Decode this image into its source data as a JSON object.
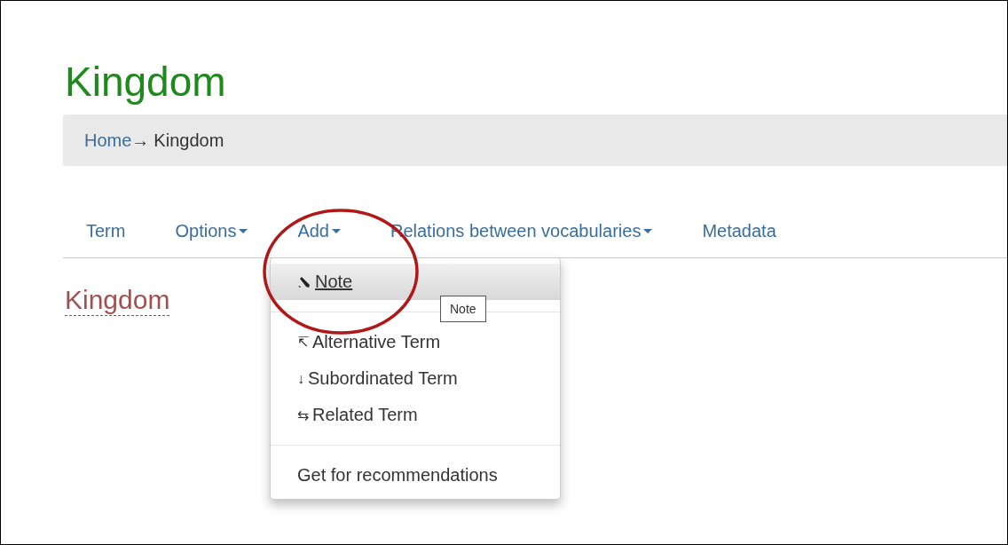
{
  "page_title": "Kingdom",
  "breadcrumb": {
    "items": [
      "Home",
      "Kingdom"
    ],
    "separator": "→"
  },
  "tabs": [
    {
      "label": "Term",
      "dropdown": false
    },
    {
      "label": "Options",
      "dropdown": true
    },
    {
      "label": "Add",
      "dropdown": true,
      "open": true
    },
    {
      "label": "Relations between vocabularies",
      "dropdown": true
    },
    {
      "label": "Metadata",
      "dropdown": false
    }
  ],
  "open_menu": {
    "groups": [
      [
        {
          "kind": "edit",
          "label": "Note",
          "selected": true
        }
      ],
      [
        {
          "kind": "glyph",
          "glyph": "↸",
          "label": "Alternative Term",
          "selected": false
        },
        {
          "kind": "glyph",
          "glyph": "↓",
          "label": "Subordinated Term",
          "selected": false
        },
        {
          "kind": "glyph",
          "glyph": "⇆",
          "label": "Related Term",
          "selected": false
        }
      ],
      [
        {
          "kind": "plain",
          "label": "Get for recommendations",
          "selected": false
        }
      ]
    ]
  },
  "tooltip": "Note",
  "term_heading": "Kingdom"
}
